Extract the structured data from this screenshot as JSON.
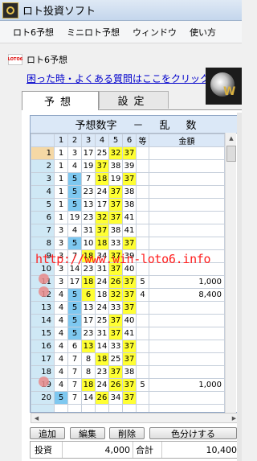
{
  "window": {
    "title": "ロト投資ソフト"
  },
  "menu": [
    "ロト6予想",
    "ミニロト予想",
    "ウィンドウ",
    "使い方"
  ],
  "mdi": {
    "icon_text": "LOTO6",
    "title": "ロト6予想"
  },
  "help_link": "困った時・よくある質問はここをクリック",
  "tabs": [
    "予想",
    "設定"
  ],
  "grid": {
    "title_parts": [
      "予想数字",
      "－",
      "乱",
      "数"
    ],
    "headers": [
      "",
      "1",
      "2",
      "3",
      "4",
      "5",
      "6",
      "等",
      "金額"
    ],
    "rows": [
      {
        "n": "1",
        "nums": [
          "1",
          "3",
          "17",
          "25",
          "32",
          "37"
        ],
        "hl": [
          "",
          "",
          "",
          "",
          "y",
          "y"
        ],
        "rank": "",
        "amount": ""
      },
      {
        "n": "2",
        "nums": [
          "1",
          "4",
          "19",
          "37",
          "38",
          "39"
        ],
        "hl": [
          "",
          "",
          "",
          "y",
          "",
          ""
        ],
        "rank": "",
        "amount": ""
      },
      {
        "n": "3",
        "nums": [
          "1",
          "5",
          "7",
          "18",
          "19",
          "37"
        ],
        "hl": [
          "",
          "b",
          "",
          "y",
          "",
          "y"
        ],
        "rank": "",
        "amount": ""
      },
      {
        "n": "4",
        "nums": [
          "1",
          "5",
          "23",
          "24",
          "37",
          "38"
        ],
        "hl": [
          "",
          "b",
          "",
          "",
          "y",
          ""
        ],
        "rank": "",
        "amount": ""
      },
      {
        "n": "5",
        "nums": [
          "1",
          "5",
          "13",
          "17",
          "37",
          "38"
        ],
        "hl": [
          "",
          "b",
          "",
          "",
          "y",
          ""
        ],
        "rank": "",
        "amount": ""
      },
      {
        "n": "6",
        "nums": [
          "1",
          "19",
          "23",
          "32",
          "37",
          "41"
        ],
        "hl": [
          "",
          "",
          "",
          "y",
          "y",
          ""
        ],
        "rank": "",
        "amount": ""
      },
      {
        "n": "7",
        "nums": [
          "3",
          "4",
          "31",
          "37",
          "38",
          "41"
        ],
        "hl": [
          "",
          "",
          "",
          "y",
          "",
          ""
        ],
        "rank": "",
        "amount": ""
      },
      {
        "n": "8",
        "nums": [
          "3",
          "5",
          "10",
          "18",
          "33",
          "37"
        ],
        "hl": [
          "",
          "b",
          "",
          "y",
          "",
          "y"
        ],
        "rank": "",
        "amount": ""
      },
      {
        "n": "9",
        "nums": [
          "3",
          "7",
          "18",
          "34",
          "37",
          "39"
        ],
        "hl": [
          "",
          "",
          "y",
          "",
          "y",
          ""
        ],
        "rank": "",
        "amount": ""
      },
      {
        "n": "10",
        "nums": [
          "3",
          "14",
          "23",
          "31",
          "37",
          "40"
        ],
        "hl": [
          "",
          "",
          "",
          "",
          "y",
          ""
        ],
        "rank": "",
        "amount": ""
      },
      {
        "n": "11",
        "nums": [
          "3",
          "17",
          "18",
          "24",
          "26",
          "37"
        ],
        "hl": [
          "",
          "",
          "y",
          "",
          "y",
          "y"
        ],
        "rank": "5",
        "amount": "1,000"
      },
      {
        "n": "12",
        "nums": [
          "4",
          "5",
          "6",
          "18",
          "32",
          "37"
        ],
        "hl": [
          "",
          "b",
          "y",
          "",
          "y",
          "y"
        ],
        "rank": "4",
        "amount": "8,400"
      },
      {
        "n": "13",
        "nums": [
          "4",
          "5",
          "13",
          "24",
          "33",
          "37"
        ],
        "hl": [
          "",
          "b",
          "",
          "",
          "",
          "y"
        ],
        "rank": "",
        "amount": ""
      },
      {
        "n": "14",
        "nums": [
          "4",
          "5",
          "17",
          "25",
          "37",
          "40"
        ],
        "hl": [
          "",
          "b",
          "",
          "",
          "y",
          ""
        ],
        "rank": "",
        "amount": ""
      },
      {
        "n": "15",
        "nums": [
          "4",
          "5",
          "23",
          "31",
          "37",
          "41"
        ],
        "hl": [
          "",
          "b",
          "",
          "",
          "y",
          ""
        ],
        "rank": "",
        "amount": ""
      },
      {
        "n": "16",
        "nums": [
          "4",
          "6",
          "13",
          "14",
          "33",
          "37"
        ],
        "hl": [
          "",
          "",
          "y",
          "",
          "",
          "y"
        ],
        "rank": "",
        "amount": ""
      },
      {
        "n": "17",
        "nums": [
          "4",
          "7",
          "8",
          "18",
          "25",
          "37"
        ],
        "hl": [
          "",
          "",
          "",
          "y",
          "",
          "y"
        ],
        "rank": "",
        "amount": ""
      },
      {
        "n": "18",
        "nums": [
          "4",
          "7",
          "8",
          "23",
          "37",
          "38"
        ],
        "hl": [
          "",
          "",
          "",
          "",
          "y",
          ""
        ],
        "rank": "",
        "amount": ""
      },
      {
        "n": "19",
        "nums": [
          "4",
          "7",
          "18",
          "24",
          "26",
          "37"
        ],
        "hl": [
          "",
          "",
          "y",
          "",
          "y",
          "y"
        ],
        "rank": "5",
        "amount": "1,000"
      },
      {
        "n": "20",
        "nums": [
          "5",
          "7",
          "14",
          "26",
          "34",
          "37"
        ],
        "hl": [
          "b",
          "",
          "",
          "y",
          "",
          "y"
        ],
        "rank": "",
        "amount": ""
      }
    ]
  },
  "watermark": "http://www.win-loto6.info",
  "buttons": [
    "追加",
    "編集",
    "削除",
    "色分けする"
  ],
  "totals": {
    "invest_label": "投資",
    "invest_value": "4,000",
    "total_label": "合計",
    "total_value": "10,400"
  },
  "colors": {
    "yellow": "#ffff33",
    "blue": "#7ec8f0",
    "row_header": "#cfe8f5",
    "link": "#0000cc",
    "watermark": "#ff2020"
  },
  "banner_text": "W"
}
